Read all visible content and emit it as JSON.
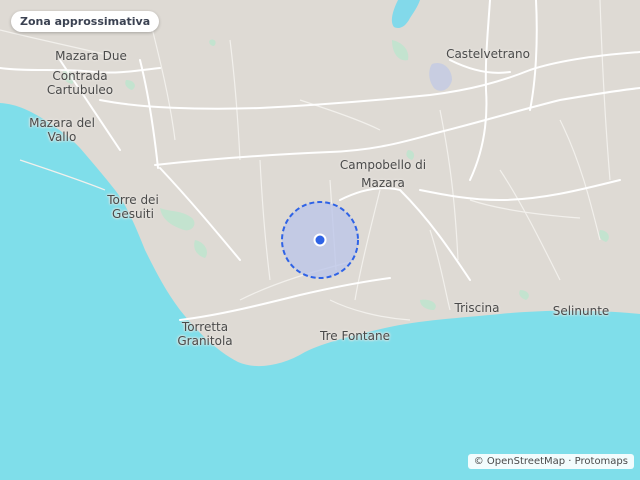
{
  "badge": {
    "label": "Zona approssimativa"
  },
  "attribution": {
    "symbol": "©",
    "text": "OpenStreetMap · Protomaps"
  },
  "colors": {
    "land": "#dedad4",
    "sea": "#7fdeea",
    "road": "#ffffff",
    "park": "#c3e3cf",
    "lake": "#82d9ea",
    "accuracy_fill": "#b9c4ea",
    "accuracy_stroke": "#2f63e6",
    "marker": "#2f63e6"
  },
  "places": [
    {
      "key": "mazara-due",
      "lines": [
        "Mazara Due"
      ]
    },
    {
      "key": "contrada-cartubuleo",
      "lines": [
        "Contrada",
        "Cartubuleo"
      ]
    },
    {
      "key": "mazara-del-vallo",
      "lines": [
        "Mazara del",
        "Vallo"
      ]
    },
    {
      "key": "torre-dei-gesuiti",
      "lines": [
        "Torre dei",
        "Gesuiti"
      ]
    },
    {
      "key": "campobello-di-mazara",
      "lines": [
        "Campobello di",
        "Mazara"
      ]
    },
    {
      "key": "castelvetrano",
      "lines": [
        "Castelvetrano"
      ]
    },
    {
      "key": "torretta-granitola",
      "lines": [
        "Torretta",
        "Granitola"
      ]
    },
    {
      "key": "tre-fontane",
      "lines": [
        "Tre Fontane"
      ]
    },
    {
      "key": "triscina",
      "lines": [
        "Triscina"
      ]
    },
    {
      "key": "selinunte",
      "lines": [
        "Selinunte"
      ]
    }
  ],
  "location_marker": {
    "icon": "location-dot-icon",
    "accuracy": "approximate"
  }
}
